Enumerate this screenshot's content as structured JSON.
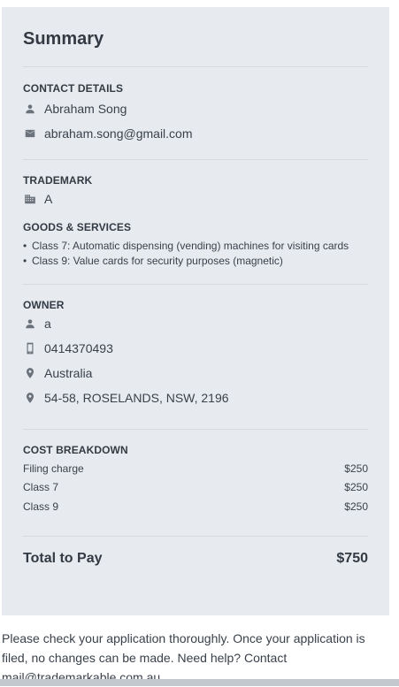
{
  "summary": {
    "title": "Summary"
  },
  "contact": {
    "heading": "CONTACT DETAILS",
    "name": "Abraham Song",
    "email": "abraham.song@gmail.com"
  },
  "trademark": {
    "heading": "TRADEMARK",
    "value": "A"
  },
  "goods": {
    "heading": "GOODS & SERVICES",
    "items": [
      "Class 7: Automatic dispensing (vending) machines for visiting cards",
      "Class 9: Value cards for security purposes (magnetic)"
    ]
  },
  "owner": {
    "heading": "OWNER",
    "name": "a",
    "phone": "0414370493",
    "country": "Australia",
    "address": "54-58, ROSELANDS, NSW, 2196"
  },
  "cost": {
    "heading": "COST BREAKDOWN",
    "items": [
      {
        "label": "Filing charge",
        "amount": "$250"
      },
      {
        "label": "Class 7",
        "amount": "$250"
      },
      {
        "label": "Class 9",
        "amount": "$250"
      }
    ]
  },
  "total": {
    "label": "Total to Pay",
    "amount": "$750"
  },
  "footer": {
    "text": "Please check your application thoroughly. Once your application is filed, no changes can be made. Need help? Contact mail@trademarkable.com.au"
  },
  "icons": {
    "person": "person-icon",
    "mail": "mail-icon",
    "building": "building-icon",
    "phone": "phone-icon",
    "location": "location-pin-icon"
  }
}
